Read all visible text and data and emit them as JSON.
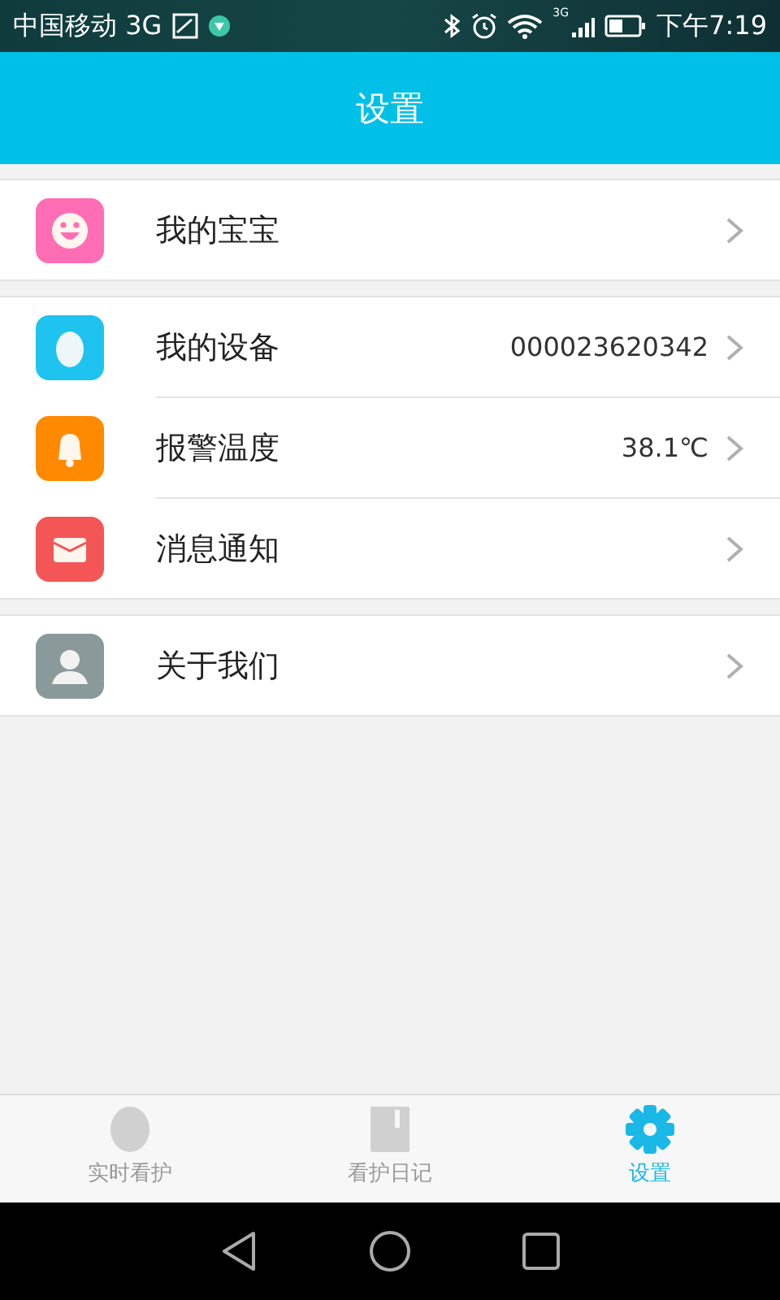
{
  "status_bar": {
    "carrier": "中国移动 3G",
    "network": "3G",
    "time": "下午7:19"
  },
  "header": {
    "title": "设置"
  },
  "groups": [
    {
      "items": [
        {
          "kind": "smile",
          "color": "#ff6eb4",
          "label": "我的宝宝"
        }
      ]
    },
    {
      "items": [
        {
          "kind": "egg",
          "color": "#1ec3ef",
          "label": "我的设备",
          "value": "000023620342"
        },
        {
          "kind": "bell",
          "color": "#ff8a00",
          "label": "报警温度",
          "value": "38.1℃"
        },
        {
          "kind": "mail",
          "color": "#f45555",
          "label": "消息通知"
        }
      ]
    },
    {
      "items": [
        {
          "kind": "person",
          "color": "#8a9a9a",
          "label": "关于我们"
        }
      ]
    }
  ],
  "tabs": [
    {
      "kind": "egg",
      "label": "实时看护",
      "selected": false
    },
    {
      "kind": "book",
      "label": "看护日记",
      "selected": false
    },
    {
      "kind": "gear",
      "label": "设置",
      "selected": true
    }
  ]
}
